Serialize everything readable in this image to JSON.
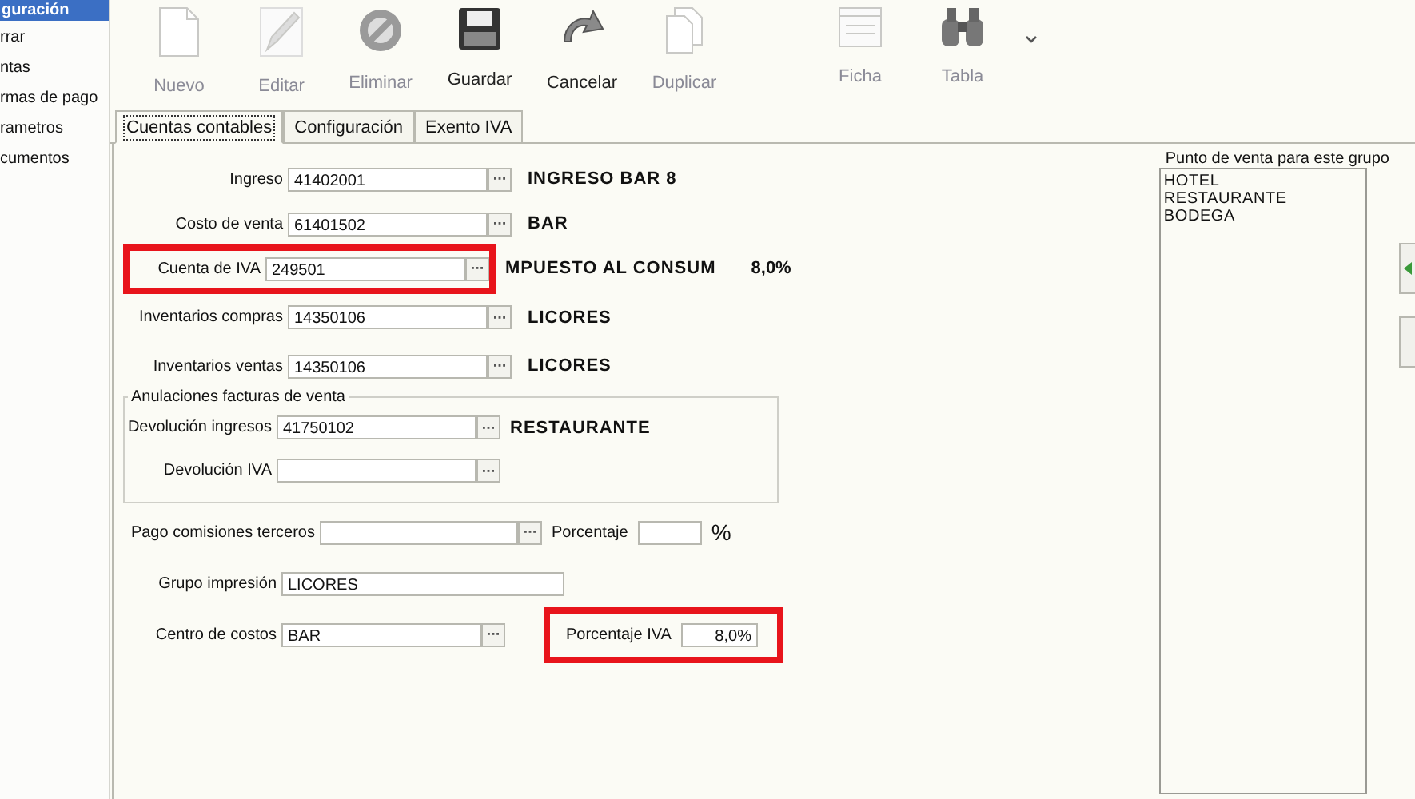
{
  "sidebar": {
    "header": "guración",
    "items": [
      {
        "label": "rrar"
      },
      {
        "label": "ntas"
      },
      {
        "label": "rmas de pago"
      },
      {
        "label": "rametros"
      },
      {
        "label": "cumentos"
      }
    ]
  },
  "toolbar": {
    "buttons": [
      {
        "label": "Nuevo",
        "kind": "document",
        "disabled": true
      },
      {
        "label": "Editar",
        "kind": "pencil",
        "disabled": true
      },
      {
        "label": "Eliminar",
        "kind": "prohibit",
        "disabled": true
      },
      {
        "label": "Guardar",
        "kind": "floppy",
        "disabled": false
      },
      {
        "label": "Cancelar",
        "kind": "undo",
        "disabled": false
      },
      {
        "label": "Duplicar",
        "kind": "copy",
        "disabled": true
      },
      {
        "label": "Ficha",
        "kind": "form",
        "disabled": true
      },
      {
        "label": "Tabla",
        "kind": "binoculars",
        "disabled": true
      }
    ]
  },
  "tabs": [
    {
      "label": "Cuentas contables",
      "selected": true
    },
    {
      "label": "Configuración",
      "selected": false
    },
    {
      "label": "Exento IVA",
      "selected": false
    }
  ],
  "accounts": [
    {
      "label": "Ingreso",
      "value": "41402001",
      "description": "INGRESO BAR 8",
      "highlighted": false
    },
    {
      "label": "Costo de venta",
      "value": "61401502",
      "description": "BAR",
      "highlighted": false
    },
    {
      "label": "Cuenta de IVA",
      "value": "249501",
      "description": "MPUESTO AL CONSUM",
      "rate": "8,0%",
      "highlighted": true
    },
    {
      "label": "Inventarios compras",
      "value": "14350106",
      "description": "LICORES",
      "highlighted": false
    },
    {
      "label": "Inventarios ventas",
      "value": "14350106",
      "description": "LICORES",
      "highlighted": false
    }
  ],
  "voids_group": {
    "legend": "Anulaciones facturas de venta",
    "fields": [
      {
        "label": "Devolución ingresos",
        "value": "41750102",
        "description": "RESTAURANTE"
      },
      {
        "label": "Devolución IVA"
      }
    ]
  },
  "commissions": {
    "label": "Pago comisiones terceros",
    "percent_label": "Porcentaje",
    "unit": "%"
  },
  "print_group": {
    "label": "Grupo impresión",
    "value": "LICORES"
  },
  "cost_center": {
    "label": "Centro de costos",
    "value": "BAR",
    "vat": {
      "label": "Porcentaje IVA",
      "value": "8,0%",
      "highlighted": true
    }
  },
  "points_of_sale": {
    "legend": "Punto de venta para este grupo",
    "items": [
      "HOTEL",
      "RESTAURANTE",
      "BODEGA"
    ]
  }
}
